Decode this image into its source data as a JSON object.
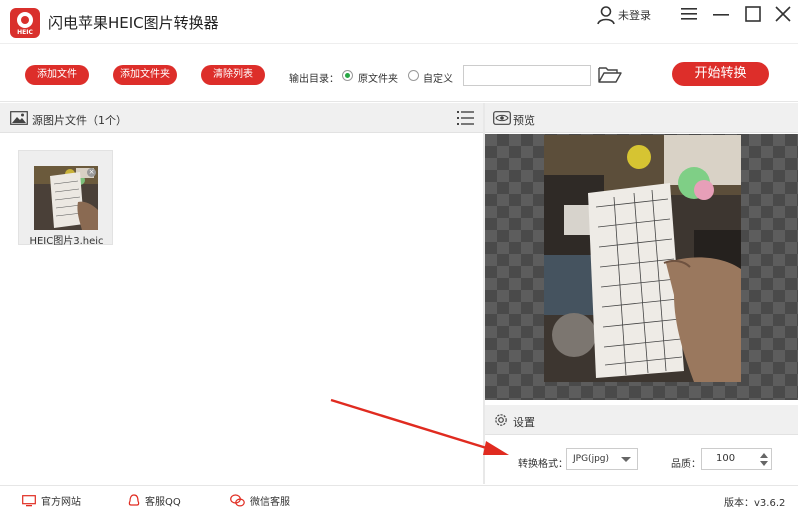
{
  "app": {
    "title": "闪电苹果HEIC图片转换器",
    "logo_text": "HEIC",
    "user_label": "未登录"
  },
  "toolbar": {
    "add_file": "添加文件",
    "add_folder": "添加文件夹",
    "clear_list": "清除列表",
    "output_dir_label": "输出目录：",
    "option_source_folder": "原文件夹",
    "option_custom": "自定义",
    "selected_option": "原文件夹",
    "path_value": "",
    "start": "开始转换"
  },
  "source_panel": {
    "title": "源图片文件（1个）",
    "files": [
      {
        "name": "HEIC图片3.heic"
      }
    ]
  },
  "preview_panel": {
    "title": "预览"
  },
  "settings_panel": {
    "title": "设置",
    "format_label": "转换格式：",
    "format_value": "JPG(jpg)",
    "quality_label": "品质：",
    "quality_value": "100"
  },
  "footer": {
    "website": "官方网站",
    "qq": "客服QQ",
    "wechat": "微信客服",
    "version": "版本：v3.6.2"
  },
  "colors": {
    "accent_red": "#dd2e2a",
    "radio_checked": "#28a745",
    "annotation_arrow": "#e02b20"
  },
  "icons": {
    "user": "user-icon",
    "menu": "menu-icon",
    "minimize": "minimize-icon",
    "maximize": "maximize-icon",
    "close": "close-icon",
    "folder": "folder-open-icon",
    "image": "image-icon",
    "list": "list-icon",
    "eye": "eye-icon",
    "gear": "gear-icon",
    "monitor": "monitor-icon",
    "qq": "qq-icon",
    "wechat": "wechat-icon"
  }
}
